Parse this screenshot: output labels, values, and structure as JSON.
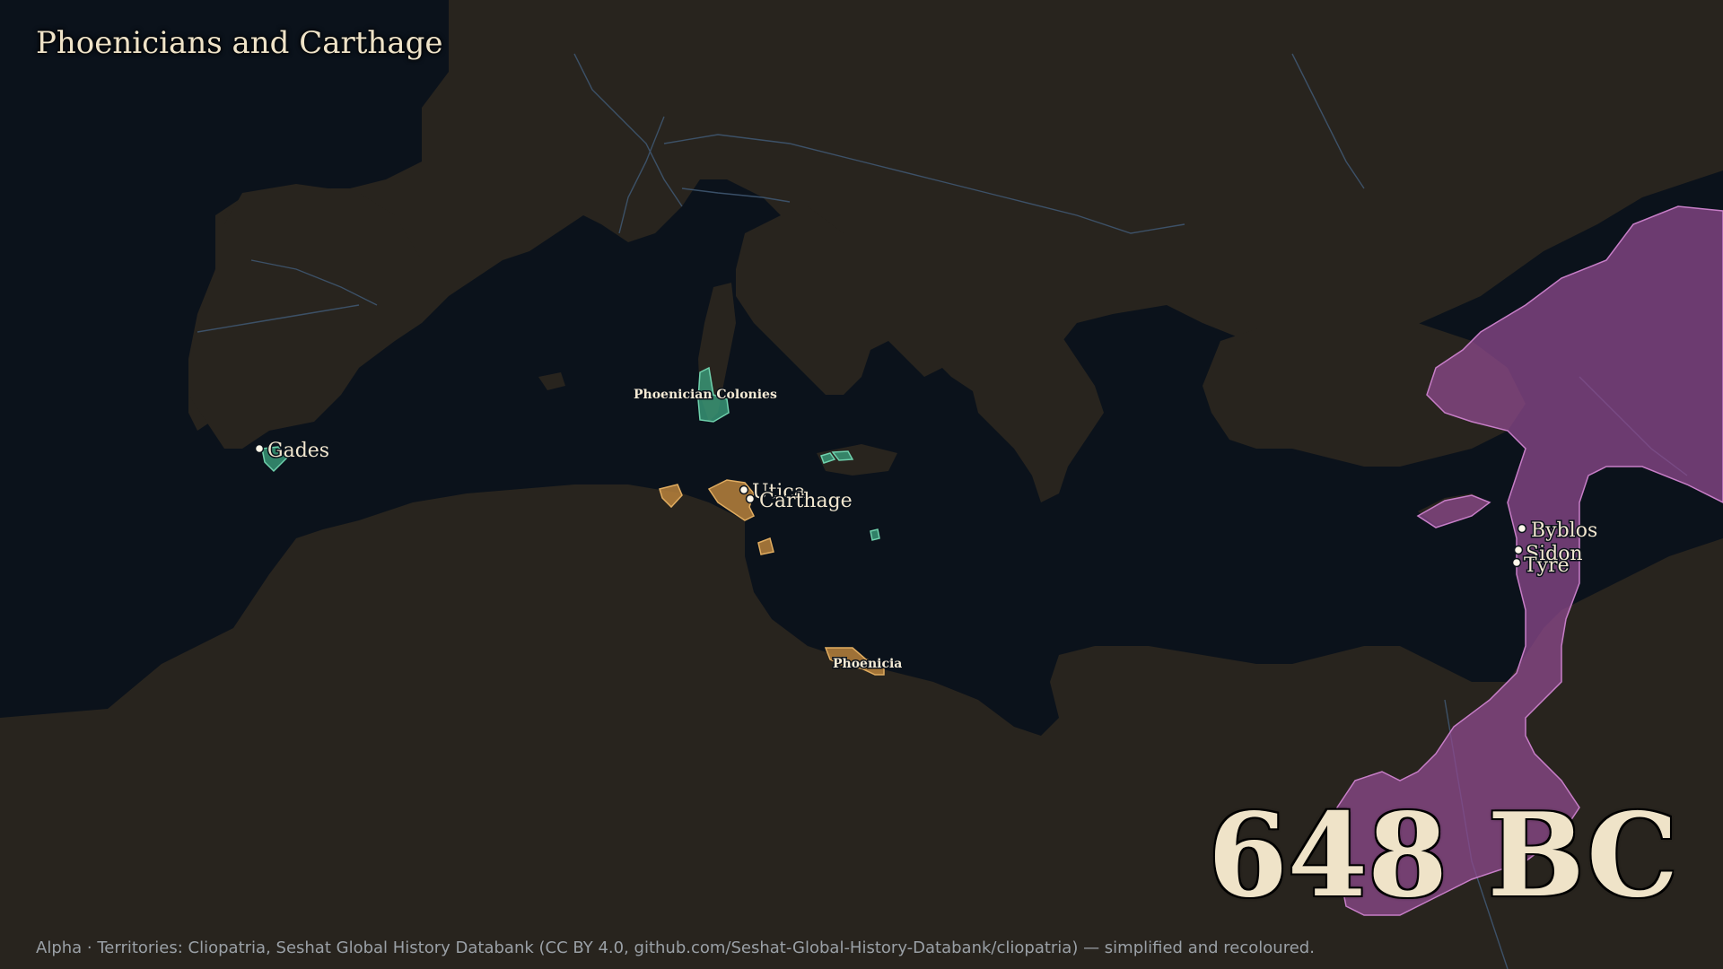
{
  "map": {
    "title": "Phoenicians and Carthage",
    "year_label": "648 BC",
    "attribution": "Alpha · Territories: Cliopatria, Seshat Global History Databank (CC BY 4.0, github.com/Seshat-Global-History-Databank/cliopatria) — simplified and recoloured."
  },
  "colors": {
    "sea": "#0b121b",
    "land": "#28241e",
    "rivers": "#3f5670",
    "phoenicia": "#b9823c",
    "phoenician_colonies": "#3a9c7a",
    "assyria": "#8e4a8e",
    "text": "#efe3c8"
  },
  "regions": {
    "phoenician_colonies": "Phoenician Colonies",
    "phoenicia": "Phoenicia"
  },
  "cities": {
    "gades": "Gades",
    "utica": "Utica",
    "carthage": "Carthage",
    "byblos": "Byblos",
    "sidon": "Sidon",
    "tyre": "Tyre"
  }
}
